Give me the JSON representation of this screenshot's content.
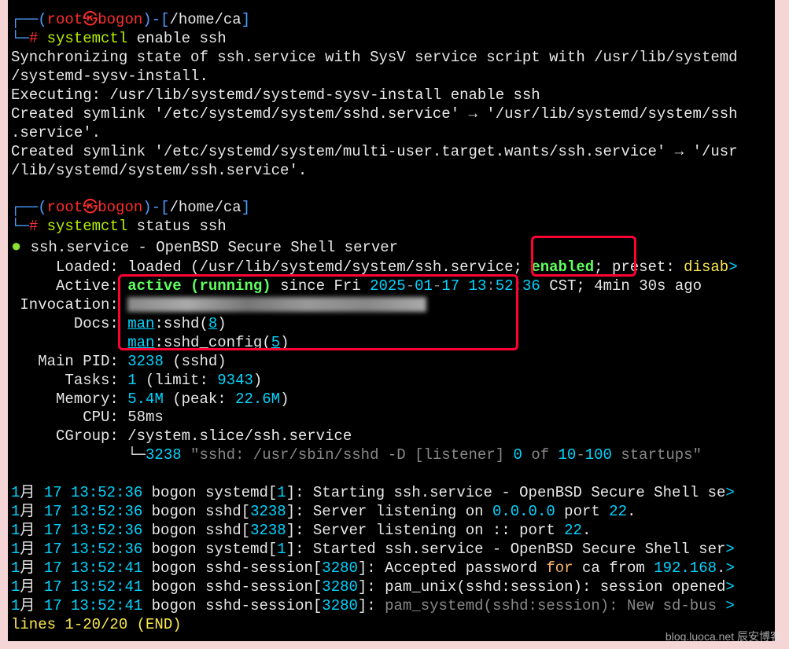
{
  "prompt1": {
    "seg1": "┌──(",
    "user": "root",
    "circ": "㉿",
    "host": "bogon",
    "seg2": ")-[",
    "path": "/home/ca",
    "seg3": "]",
    "prefix": "└─",
    "hash": "# ",
    "cmd": "systemctl",
    "rest": " enable ssh"
  },
  "out1a": "Synchronizing state of ssh.service with SysV service script with /usr/lib/systemd",
  "out1b": "/systemd-sysv-install.",
  "out1c": "Executing: /usr/lib/systemd/systemd-sysv-install enable ssh",
  "out1d": "Created symlink '/etc/systemd/system/sshd.service' → '/usr/lib/systemd/system/ssh",
  "out1e": ".service'.",
  "out1f": "Created symlink '/etc/systemd/system/multi-user.target.wants/ssh.service' → '/usr",
  "out1g": "/lib/systemd/system/ssh.service'.",
  "prompt2": {
    "cmd": "systemctl",
    "rest": " status ssh"
  },
  "svc": {
    "name": "ssh.service - OpenBSD Secure Shell server",
    "loaded_lbl": "     Loaded: loaded (/usr/lib/systemd/system/ssh.service; ",
    "enabled": "enabled",
    "preset1": "; preset: ",
    "disab": "disab",
    "gt": ">",
    "active_lbl": "     Active: ",
    "active": "active (running)",
    "since": " since Fri ",
    "date1": "2025",
    "dash": "-",
    "date2": "01",
    "date3": "17",
    "sp": " ",
    "time1": "13",
    "colon": ":",
    "time2": "52",
    "time3": "36",
    "cst": " CST; 4min 30s ago",
    "invoc": " Invocation: ",
    "docs_lbl": "       Docs: ",
    "man1": "man",
    "sshd8a": ":sshd(",
    "eight": "8",
    "sshd8b": ")",
    "pad": "             ",
    "sshdcfg_a": ":sshd_config(",
    "five": "5",
    "sshdcfg_b": ")",
    "pid_lbl": "   Main PID: ",
    "pid": "3238",
    "pid_sfx": " (sshd)",
    "tasks_lbl": "      Tasks: ",
    "tasks": "1",
    "limit_a": " (limit: ",
    "limit": "9343",
    "limit_b": ")",
    "mem_lbl": "     Memory: ",
    "mem": "5.4M",
    "mem_peak_a": " (peak: ",
    "mem_peak": "22.6M",
    "mem_peak_b": ")",
    "cpu_lbl": "        CPU: 58ms",
    "cgrp_lbl": "     CGroup: /system.slice/ssh.service",
    "tree": "             └─",
    "tree_pid": "3238",
    "proc_a": " \"sshd: /usr/sbin/sshd -D [listener] ",
    "zero": "0",
    "of": " of ",
    "ten": "10",
    "hund": "100",
    "startups": " startups\""
  },
  "log": {
    "m1": "1",
    "month": "月 ",
    "d": "17",
    "t1": "13:52:36",
    "t2": "13:52:41",
    "l1a": " bogon systemd[",
    "one": "1",
    "l1b": "]: Starting ssh.service - OpenBSD Secure Shell se",
    "l2a": " bogon sshd[",
    "l2pid": "3238",
    "l2b": "]: Server listening on ",
    "zeros": "0.0.0.0",
    "port": " port ",
    "p22": "22",
    "dot": ".",
    "l3b": "]: Server listening on :: port ",
    "l4b": "]: Started ssh.service - OpenBSD Secure Shell ser",
    "l5a": " bogon sshd-session[",
    "l5pid": "3280",
    "l5b": "]: Accepted password ",
    "for": "for",
    "l5c": " ca from ",
    "ip": "192.168",
    "l5d": ".",
    "l6b": "]: pam_unix(sshd:session): session opened",
    "l7b": "]: ",
    "l7c": "pam_systemd(sshd:session): New sd-bus ",
    "end": "lines 1-20/20 (END)"
  },
  "watermark": "blog.luoca.net 辰安博客"
}
